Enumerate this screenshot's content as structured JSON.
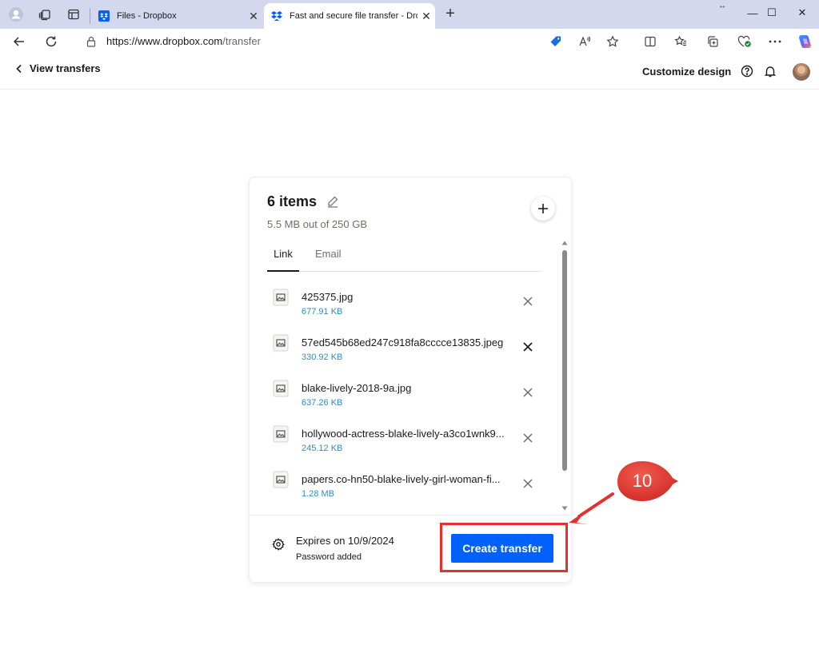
{
  "browser": {
    "tabs": [
      {
        "title": "Files - Dropbox",
        "close": "✕",
        "favicon": "dropbox-icon"
      },
      {
        "title": "Fast and secure file transfer - Dro",
        "close": "✕",
        "favicon": "dropbox-icon"
      }
    ],
    "new_tab": "+",
    "window_controls": {
      "minimize": "—",
      "maximize": "☐",
      "close": "✕"
    },
    "url_host": "https://www.dropbox.com",
    "url_path": "/transfer"
  },
  "header": {
    "back_label": "View transfers",
    "customize_label": "Customize design"
  },
  "transfer": {
    "title": "6 items",
    "subtitle": "5.5 MB out of 250 GB",
    "tabs": {
      "link": "Link",
      "email": "Email"
    },
    "files": [
      {
        "name": "425375.jpg",
        "size": "677.91 KB"
      },
      {
        "name": "57ed545b68ed247c918fa8cccce13835.jpeg",
        "size": "330.92 KB"
      },
      {
        "name": "blake-lively-2018-9a.jpg",
        "size": "637.26 KB"
      },
      {
        "name": "hollywood-actress-blake-lively-a3co1wnk9...",
        "size": "245.12 KB"
      },
      {
        "name": "papers.co-hn50-blake-lively-girl-woman-fi...",
        "size": "1.28 MB"
      }
    ],
    "expires": "Expires on 10/9/2024",
    "password": "Password added",
    "create_label": "Create transfer"
  },
  "annotation": {
    "step": "10",
    "color": "#e6302f"
  },
  "colors": {
    "accent": "#0061fe",
    "file_size": "#2b8ec7",
    "tabbar": "#d3d8ef"
  }
}
